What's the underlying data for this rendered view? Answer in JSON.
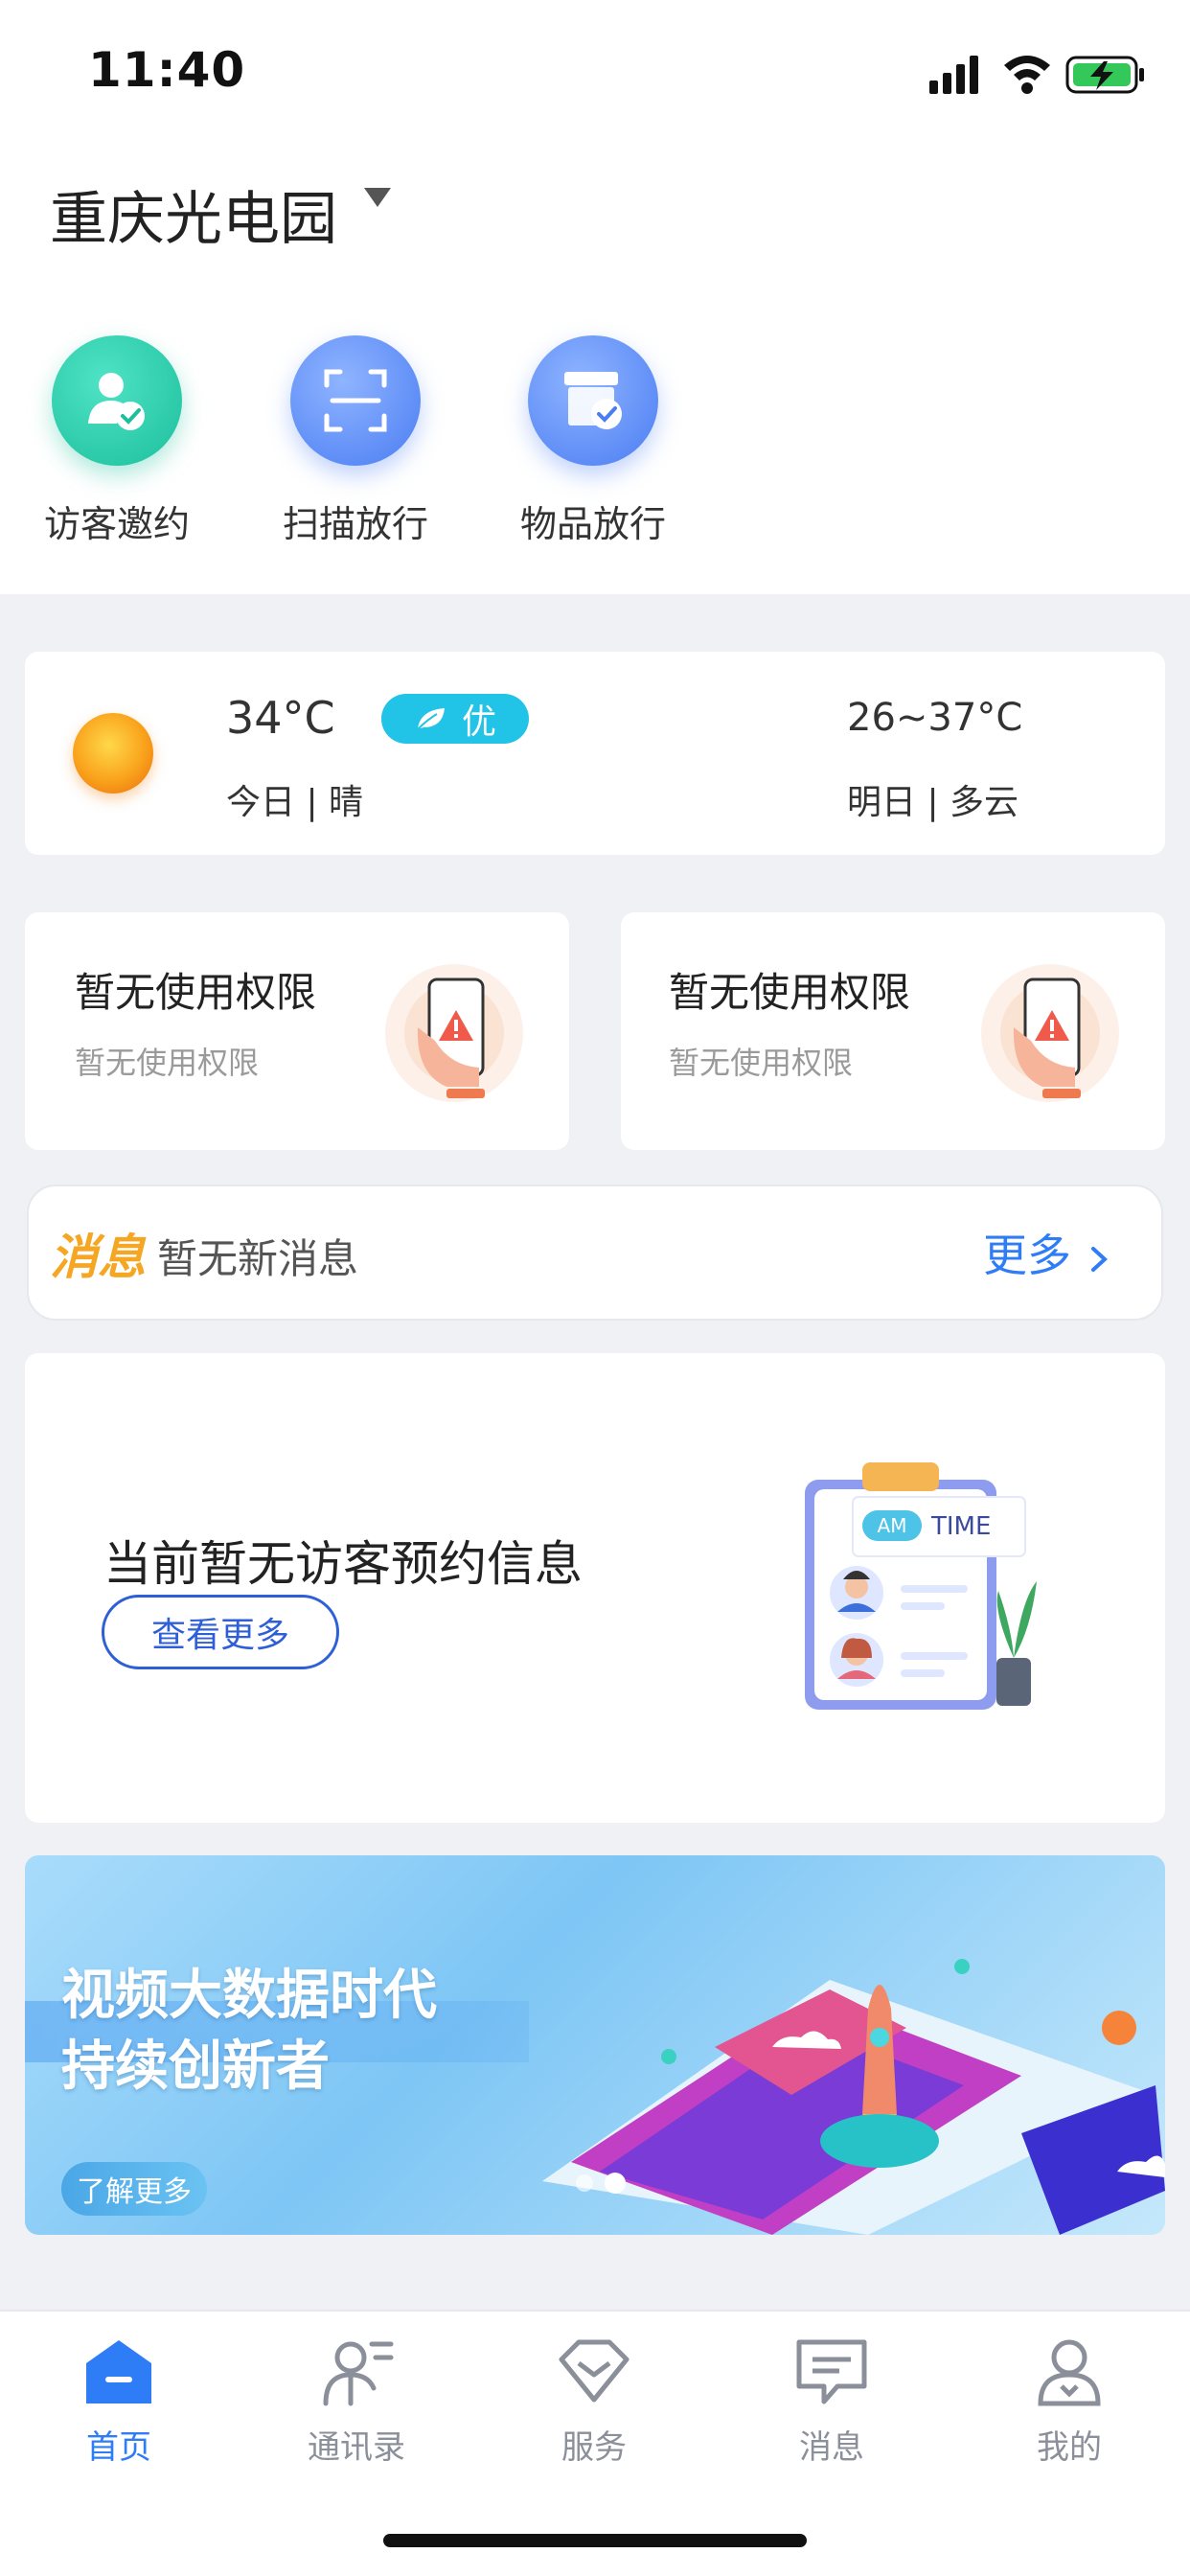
{
  "status_bar": {
    "time": "11:40"
  },
  "header": {
    "park_name": "重庆光电园"
  },
  "quick_actions": [
    {
      "label": "访客邀约",
      "icon": "visitor-invite-icon",
      "color": "#1cbf9c"
    },
    {
      "label": "扫描放行",
      "icon": "scan-icon",
      "color": "#4a7df3"
    },
    {
      "label": "物品放行",
      "icon": "item-release-icon",
      "color": "#4a7df3"
    }
  ],
  "weather": {
    "temperature": "34°C",
    "aqi": "优",
    "today": "今日 | 晴",
    "tomorrow_range": "26~37°C",
    "tomorrow": "明日 | 多云"
  },
  "permissions": [
    {
      "title": "暂无使用权限",
      "subtitle": "暂无使用权限"
    },
    {
      "title": "暂无使用权限",
      "subtitle": "暂无使用权限"
    }
  ],
  "messages": {
    "tag": "消息",
    "text": "暂无新消息",
    "more": "更多"
  },
  "visitor": {
    "text": "当前暂无访客预约信息",
    "button": "查看更多",
    "am": "AM",
    "time": "TIME"
  },
  "banner": {
    "line1": "视频大数据时代",
    "line2": "持续创新者",
    "button": "了解更多"
  },
  "tabs": [
    {
      "label": "首页",
      "active": true
    },
    {
      "label": "通讯录",
      "active": false
    },
    {
      "label": "服务",
      "active": false
    },
    {
      "label": "消息",
      "active": false
    },
    {
      "label": "我的",
      "active": false
    }
  ],
  "colors": {
    "accent": "#2e7cf6",
    "message_tag": "#f5a623",
    "aqi_badge": "#21c3e6"
  }
}
